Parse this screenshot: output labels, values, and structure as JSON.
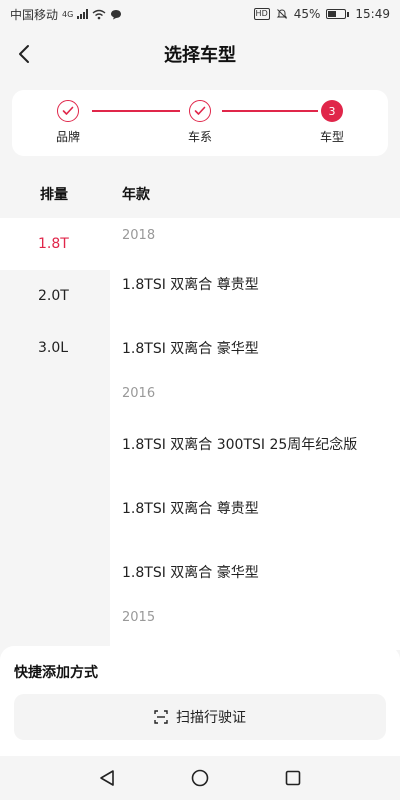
{
  "status_bar": {
    "carrier": "中国移动",
    "network": "4G",
    "battery": "45%",
    "time": "15:49",
    "hd": "HD"
  },
  "header": {
    "title": "选择车型"
  },
  "stepper": {
    "steps": [
      {
        "label": "品牌",
        "state": "done"
      },
      {
        "label": "车系",
        "state": "done"
      },
      {
        "label": "车型",
        "state": "active",
        "number": "3"
      }
    ]
  },
  "columns": {
    "left_header": "排量",
    "right_header": "年款"
  },
  "displacements": [
    "1.8T",
    "2.0T",
    "3.0L"
  ],
  "selected_displacement": "1.8T",
  "model_groups": [
    {
      "year": "2018",
      "models": [
        "1.8TSI 双离合 尊贵型",
        "1.8TSI 双离合 豪华型"
      ]
    },
    {
      "year": "2016",
      "models": [
        "1.8TSI 双离合 300TSI 25周年纪念版",
        "1.8TSI 双离合 尊贵型",
        "1.8TSI 双离合 豪华型"
      ]
    },
    {
      "year": "2015",
      "models": []
    }
  ],
  "bottom_sheet": {
    "title": "快捷添加方式",
    "scan_label": "扫描行驶证"
  },
  "colors": {
    "accent": "#e0264a"
  }
}
